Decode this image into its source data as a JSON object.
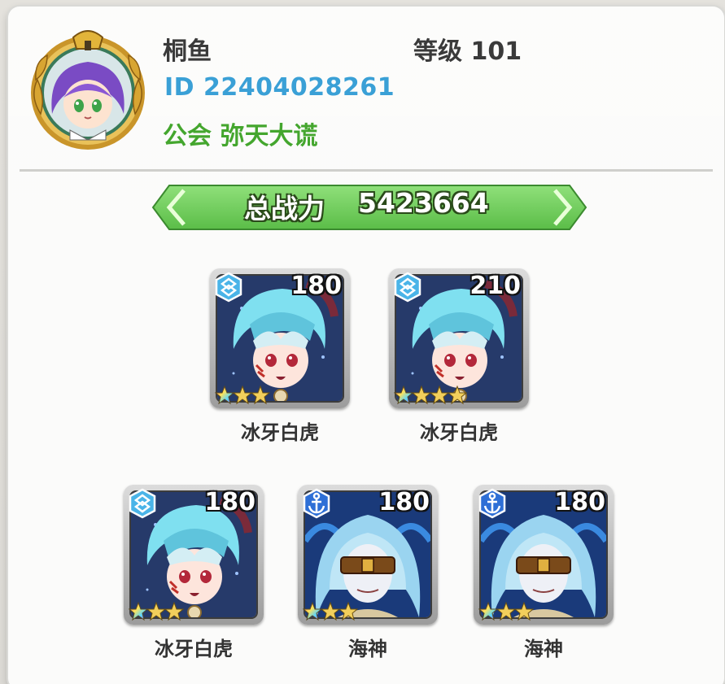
{
  "player": {
    "name": "桐鱼",
    "level_label": "等级 101",
    "id_label": "ID 22404028261",
    "guild_label": "公会 弥天大谎"
  },
  "power": {
    "label": "总战力",
    "value": "5423664"
  },
  "heroes": [
    {
      "name": "冰牙白虎",
      "level": "180",
      "type_icon": "crystal-type-icon",
      "stars": 3,
      "art": "white-tiger"
    },
    {
      "name": "冰牙白虎",
      "level": "210",
      "type_icon": "crystal-type-icon",
      "stars": 4,
      "art": "white-tiger"
    },
    {
      "name": "冰牙白虎",
      "level": "180",
      "type_icon": "crystal-type-icon",
      "stars": 3,
      "art": "white-tiger"
    },
    {
      "name": "海神",
      "level": "180",
      "type_icon": "anchor-type-icon",
      "stars": 3,
      "art": "sea-god"
    },
    {
      "name": "海神",
      "level": "180",
      "type_icon": "anchor-type-icon",
      "stars": 3,
      "art": "sea-god"
    }
  ],
  "colors": {
    "id_blue": "#3aa0d6",
    "guild_green": "#44a62e",
    "banner_green": "#6ccf5a"
  }
}
